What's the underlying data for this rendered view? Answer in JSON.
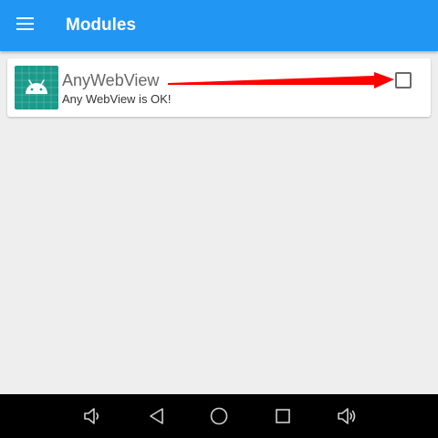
{
  "appbar": {
    "title": "Modules",
    "menu_icon": "hamburger-menu-icon",
    "color": "#2196f3"
  },
  "modules": [
    {
      "name": "AnyWebView",
      "description": "Any WebView is OK!",
      "icon": "android-robot-icon",
      "icon_color": "#1a9a8a",
      "enabled": false
    }
  ],
  "annotation": {
    "arrow_color": "#ff0000",
    "points_to": "module-enable-checkbox"
  },
  "navbar": {
    "buttons": [
      "volume-down-icon",
      "back-icon",
      "home-icon",
      "recents-icon",
      "volume-up-icon"
    ]
  }
}
